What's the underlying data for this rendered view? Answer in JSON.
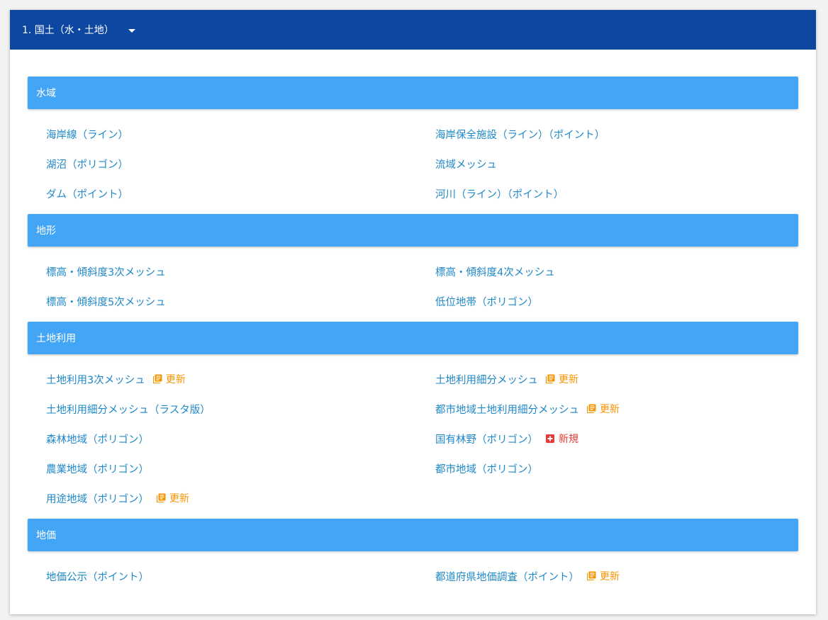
{
  "header": {
    "title": "1. 国土（水・土地）"
  },
  "badges": {
    "update": "更新",
    "new": "新規"
  },
  "colors": {
    "header_bg": "#0d47a1",
    "section_bg": "#42a5f5",
    "link": "#1e88c8",
    "update": "#f59300",
    "new": "#e53935"
  },
  "sections": [
    {
      "title": "水域",
      "items": [
        {
          "label": "海岸線（ライン）",
          "badge": ""
        },
        {
          "label": "海岸保全施設（ライン）（ポイント）",
          "badge": ""
        },
        {
          "label": "湖沼（ポリゴン）",
          "badge": ""
        },
        {
          "label": "流域メッシュ",
          "badge": ""
        },
        {
          "label": "ダム（ポイント）",
          "badge": ""
        },
        {
          "label": "河川（ライン）（ポイント）",
          "badge": ""
        }
      ]
    },
    {
      "title": "地形",
      "items": [
        {
          "label": "標高・傾斜度3次メッシュ",
          "badge": ""
        },
        {
          "label": "標高・傾斜度4次メッシュ",
          "badge": ""
        },
        {
          "label": "標高・傾斜度5次メッシュ",
          "badge": ""
        },
        {
          "label": "低位地帯（ポリゴン）",
          "badge": ""
        }
      ]
    },
    {
      "title": "土地利用",
      "items": [
        {
          "label": "土地利用3次メッシュ",
          "badge": "update"
        },
        {
          "label": "土地利用細分メッシュ",
          "badge": "update"
        },
        {
          "label": "土地利用細分メッシュ（ラスタ版）",
          "badge": ""
        },
        {
          "label": "都市地域土地利用細分メッシュ",
          "badge": "update"
        },
        {
          "label": "森林地域（ポリゴン）",
          "badge": ""
        },
        {
          "label": "国有林野（ポリゴン）",
          "badge": "new"
        },
        {
          "label": "農業地域（ポリゴン）",
          "badge": ""
        },
        {
          "label": "都市地域（ポリゴン）",
          "badge": ""
        },
        {
          "label": "用途地域（ポリゴン）",
          "badge": "update"
        }
      ]
    },
    {
      "title": "地価",
      "items": [
        {
          "label": "地価公示（ポイント）",
          "badge": ""
        },
        {
          "label": "都道府県地価調査（ポイント）",
          "badge": "update"
        }
      ]
    }
  ]
}
